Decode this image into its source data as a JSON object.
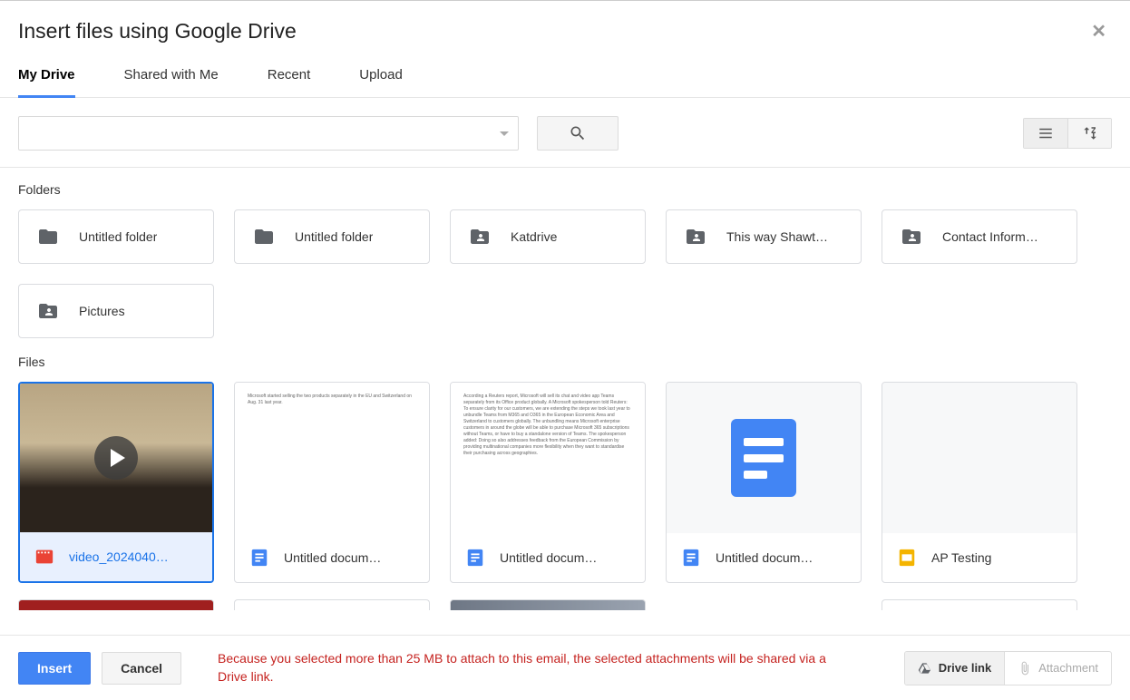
{
  "title": "Insert files using Google Drive",
  "tabs": [
    {
      "label": "My Drive",
      "active": true
    },
    {
      "label": "Shared with Me",
      "active": false
    },
    {
      "label": "Recent",
      "active": false
    },
    {
      "label": "Upload",
      "active": false
    }
  ],
  "search": {
    "placeholder": ""
  },
  "sections": {
    "folders_label": "Folders",
    "files_label": "Files"
  },
  "folders": [
    {
      "name": "Untitled folder",
      "icon": "folder"
    },
    {
      "name": "Untitled folder",
      "icon": "folder"
    },
    {
      "name": "Katdrive",
      "icon": "shared-folder"
    },
    {
      "name": "This way Shawt…",
      "icon": "shared-folder"
    },
    {
      "name": "Contact Inform…",
      "icon": "shared-folder"
    },
    {
      "name": "Pictures",
      "icon": "shared-folder"
    }
  ],
  "files": [
    {
      "name": "video_2024040…",
      "type": "video",
      "selected": true
    },
    {
      "name": "Untitled docum…",
      "type": "docs-text"
    },
    {
      "name": "Untitled docum…",
      "type": "docs-text-dense"
    },
    {
      "name": "Untitled docum…",
      "type": "docs-icon"
    },
    {
      "name": "AP Testing",
      "type": "slides"
    }
  ],
  "footer": {
    "insert_label": "Insert",
    "cancel_label": "Cancel",
    "warning": "Because you selected more than 25 MB to attach to this email, the selected attachments will be shared via a Drive link.",
    "drive_link_label": "Drive link",
    "attachment_label": "Attachment"
  },
  "thumb_text": {
    "sparse": "Microsoft started selling the two products separately in the EU and Switzerland on Aug. 31 last year.",
    "dense": "According a Reuters report, Microsoft will sell its chat and video app Teams separately from its Office product globally. A Microsoft spokesperson told Reuters: To ensure clarity for our customers, we are extending the steps we took last year to unbundle Teams from M365 and O365 in the European Economic Area and Switzerland to customers globally. The unbundling means Microsoft enterprise customers in around the globe will be able to purchase Microsoft 365 subscriptions without Teams, or have to buy a standalone version of Teams. The spokesperson added: Doing so also addresses feedback from the European Commission by providing multinational companies more flexibility when they want to standardise their purchasing across geographies."
  }
}
